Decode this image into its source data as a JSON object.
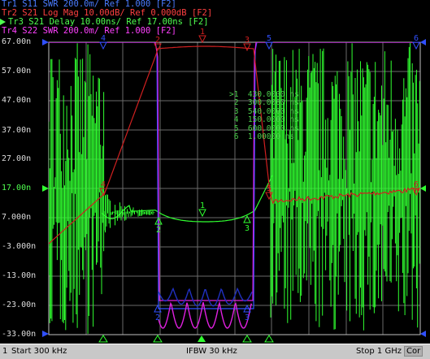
{
  "traces": [
    {
      "id": "Tr1",
      "text": "Tr1 S11 SWR 200.0m/ Ref 1.000 [F2]",
      "color": "#4a7cff"
    },
    {
      "id": "Tr2",
      "text": "Tr2 S21 Log Mag 10.00dB/ Ref 0.000dB [F2]",
      "color": "#ff4040"
    },
    {
      "id": "Tr3",
      "text": "Tr3 S21 Delay 10.00ns/ Ref 17.00ns [F2]",
      "color": "#50ff50",
      "active": true
    },
    {
      "id": "Tr4",
      "text": "Tr4 S22 SWR 200.0m/ Ref 1.000 [F2]",
      "color": "#ff40ff"
    }
  ],
  "yaxis": {
    "labels": [
      "67.00n",
      "57.00n",
      "47.00n",
      "37.00n",
      "27.00n",
      "17.00n",
      "7.000n",
      "-3.000n",
      "-13.00n",
      "-23.00n",
      "-33.00n"
    ],
    "ref_label": "17.00n"
  },
  "markers": [
    {
      "n": "1",
      "label": "1",
      "f": "430.0000"
    },
    {
      "n": "2",
      "label": "2",
      "f": "300.0000"
    },
    {
      "n": "3",
      "label": "3",
      "f": "540.0000"
    },
    {
      "n": "4",
      "label": "4",
      "f": "150.0000"
    },
    {
      "n": "5",
      "label": "5",
      "f": "600.0000"
    },
    {
      "n": "6",
      "label": "6",
      "f": "1.00000"
    }
  ],
  "marker_table": {
    "active_prefix": ">1",
    "rows_suffix": "ns"
  },
  "status": {
    "channel": "1",
    "start": "Start 300 kHz",
    "ifbw": "IFBW 30 kHz",
    "stop": "Stop 1 GHz",
    "extra": "Cor"
  },
  "colors": {
    "grid": "#707070",
    "frame": "#c0c0c0",
    "s11": "#3050ff",
    "s21mag": "#d02020",
    "delay": "#30ff30",
    "s22": "#e020e0"
  }
}
